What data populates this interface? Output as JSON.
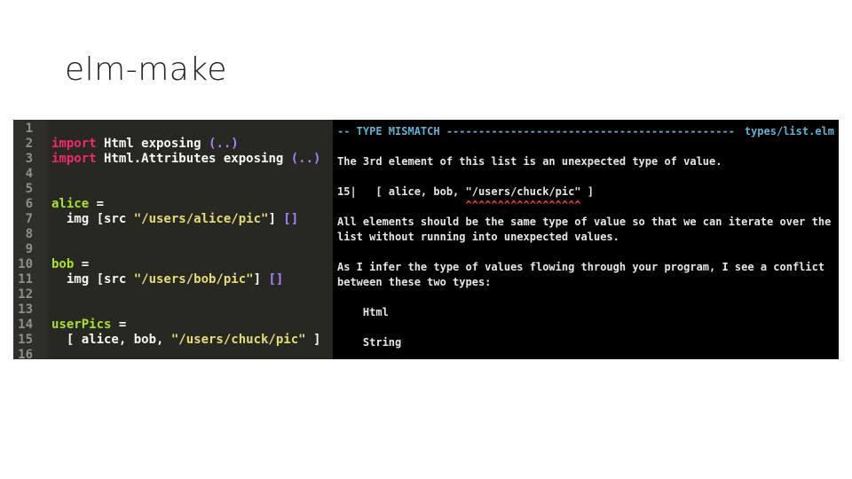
{
  "slide": {
    "title": "elm-make"
  },
  "editor": {
    "lines": [
      {
        "n": "1",
        "parts": []
      },
      {
        "n": "2",
        "parts": [
          {
            "t": "import",
            "c": "kw"
          },
          {
            "t": " Html exposing ",
            "c": ""
          },
          {
            "t": "(..)",
            "c": "pu"
          }
        ]
      },
      {
        "n": "3",
        "parts": [
          {
            "t": "import",
            "c": "kw"
          },
          {
            "t": " Html.Attributes exposing ",
            "c": ""
          },
          {
            "t": "(..)",
            "c": "pu"
          }
        ]
      },
      {
        "n": "4",
        "parts": []
      },
      {
        "n": "5",
        "parts": []
      },
      {
        "n": "6",
        "parts": [
          {
            "t": "alice",
            "c": "fn"
          },
          {
            "t": " =",
            "c": ""
          }
        ]
      },
      {
        "n": "7",
        "parts": [
          {
            "t": "  img [src ",
            "c": ""
          },
          {
            "t": "\"/users/alice/pic\"",
            "c": "str"
          },
          {
            "t": "] ",
            "c": ""
          },
          {
            "t": "[]",
            "c": "pu"
          }
        ]
      },
      {
        "n": "8",
        "parts": []
      },
      {
        "n": "9",
        "parts": []
      },
      {
        "n": "10",
        "parts": [
          {
            "t": "bob",
            "c": "fn"
          },
          {
            "t": " =",
            "c": ""
          }
        ]
      },
      {
        "n": "11",
        "parts": [
          {
            "t": "  img [src ",
            "c": ""
          },
          {
            "t": "\"/users/bob/pic\"",
            "c": "str"
          },
          {
            "t": "] ",
            "c": ""
          },
          {
            "t": "[]",
            "c": "pu"
          }
        ]
      },
      {
        "n": "12",
        "parts": []
      },
      {
        "n": "13",
        "parts": []
      },
      {
        "n": "14",
        "parts": [
          {
            "t": "userPics",
            "c": "fn"
          },
          {
            "t": " =",
            "c": ""
          }
        ]
      },
      {
        "n": "15",
        "parts": [
          {
            "t": "  [ alice, bob, ",
            "c": ""
          },
          {
            "t": "\"/users/chuck/pic\"",
            "c": "str"
          },
          {
            "t": " ]",
            "c": ""
          }
        ]
      },
      {
        "n": "16",
        "parts": []
      }
    ]
  },
  "terminal": {
    "header_left": "-- TYPE MISMATCH ---------------------------------------------",
    "header_right": "types/list.elm",
    "line_desc": "The 3rd element of this list is an unexpected type of value.",
    "code_line": "15|   [ alice, bob, \"/users/chuck/pic\" ]",
    "carets": "                    ^^^^^^^^^^^^^^^^^^",
    "explain_1": "All elements should be the same type of value so that we can iterate over the",
    "explain_2": "list without running into unexpected values.",
    "infer_1": "As I infer the type of values flowing through your program, I see a conflict",
    "infer_2": "between these two types:",
    "type_a": "    Html",
    "type_b": "    String"
  },
  "colors": {
    "editor_bg": "#272822",
    "terminal_bg": "#000000",
    "keyword": "#f92672",
    "string": "#e6db74",
    "cyan": "#5fb3d2",
    "red": "#e8473b"
  }
}
